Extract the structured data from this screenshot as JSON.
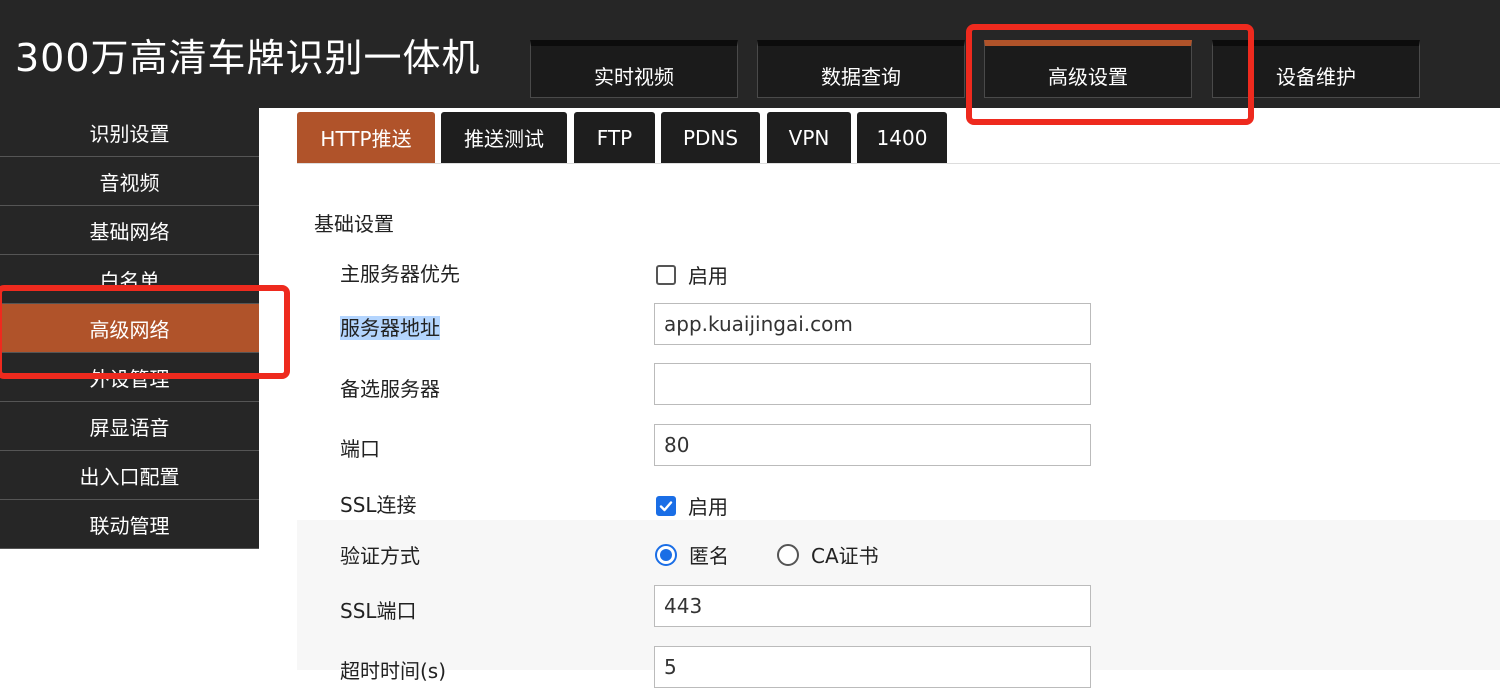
{
  "header": {
    "title": "300万高清车牌识别一体机",
    "nav": [
      {
        "label": "实时视频"
      },
      {
        "label": "数据查询"
      },
      {
        "label": "高级设置"
      },
      {
        "label": "设备维护"
      }
    ]
  },
  "sidebar": {
    "items": [
      {
        "label": "识别设置"
      },
      {
        "label": "音视频"
      },
      {
        "label": "基础网络"
      },
      {
        "label": "白名单"
      },
      {
        "label": "高级网络"
      },
      {
        "label": "外设管理"
      },
      {
        "label": "屏显语音"
      },
      {
        "label": "出入口配置"
      },
      {
        "label": "联动管理"
      }
    ]
  },
  "subtabs": [
    {
      "label": "HTTP推送"
    },
    {
      "label": "推送测试"
    },
    {
      "label": "FTP"
    },
    {
      "label": "PDNS"
    },
    {
      "label": "VPN"
    },
    {
      "label": "1400"
    }
  ],
  "form": {
    "section_title": "基础设置",
    "primary_server_first": {
      "label": "主服务器优先",
      "option": "启用",
      "checked": false
    },
    "server_address": {
      "label": "服务器地址",
      "value": "app.kuaijingai.com"
    },
    "backup_server": {
      "label": "备选服务器",
      "value": ""
    },
    "port": {
      "label": "端口",
      "value": "80"
    },
    "ssl": {
      "label": "SSL连接",
      "option": "启用",
      "checked": true
    },
    "auth": {
      "label": "验证方式",
      "options": [
        {
          "label": "匿名",
          "selected": true
        },
        {
          "label": "CA证书",
          "selected": false
        }
      ]
    },
    "ssl_port": {
      "label": "SSL端口",
      "value": "443"
    },
    "timeout": {
      "label": "超时时间(s)",
      "value": "5"
    }
  },
  "colors": {
    "accent": "#b0532a",
    "header_bg": "#262626",
    "highlight": "#ee2a1e",
    "check_blue": "#1a6ee6"
  }
}
